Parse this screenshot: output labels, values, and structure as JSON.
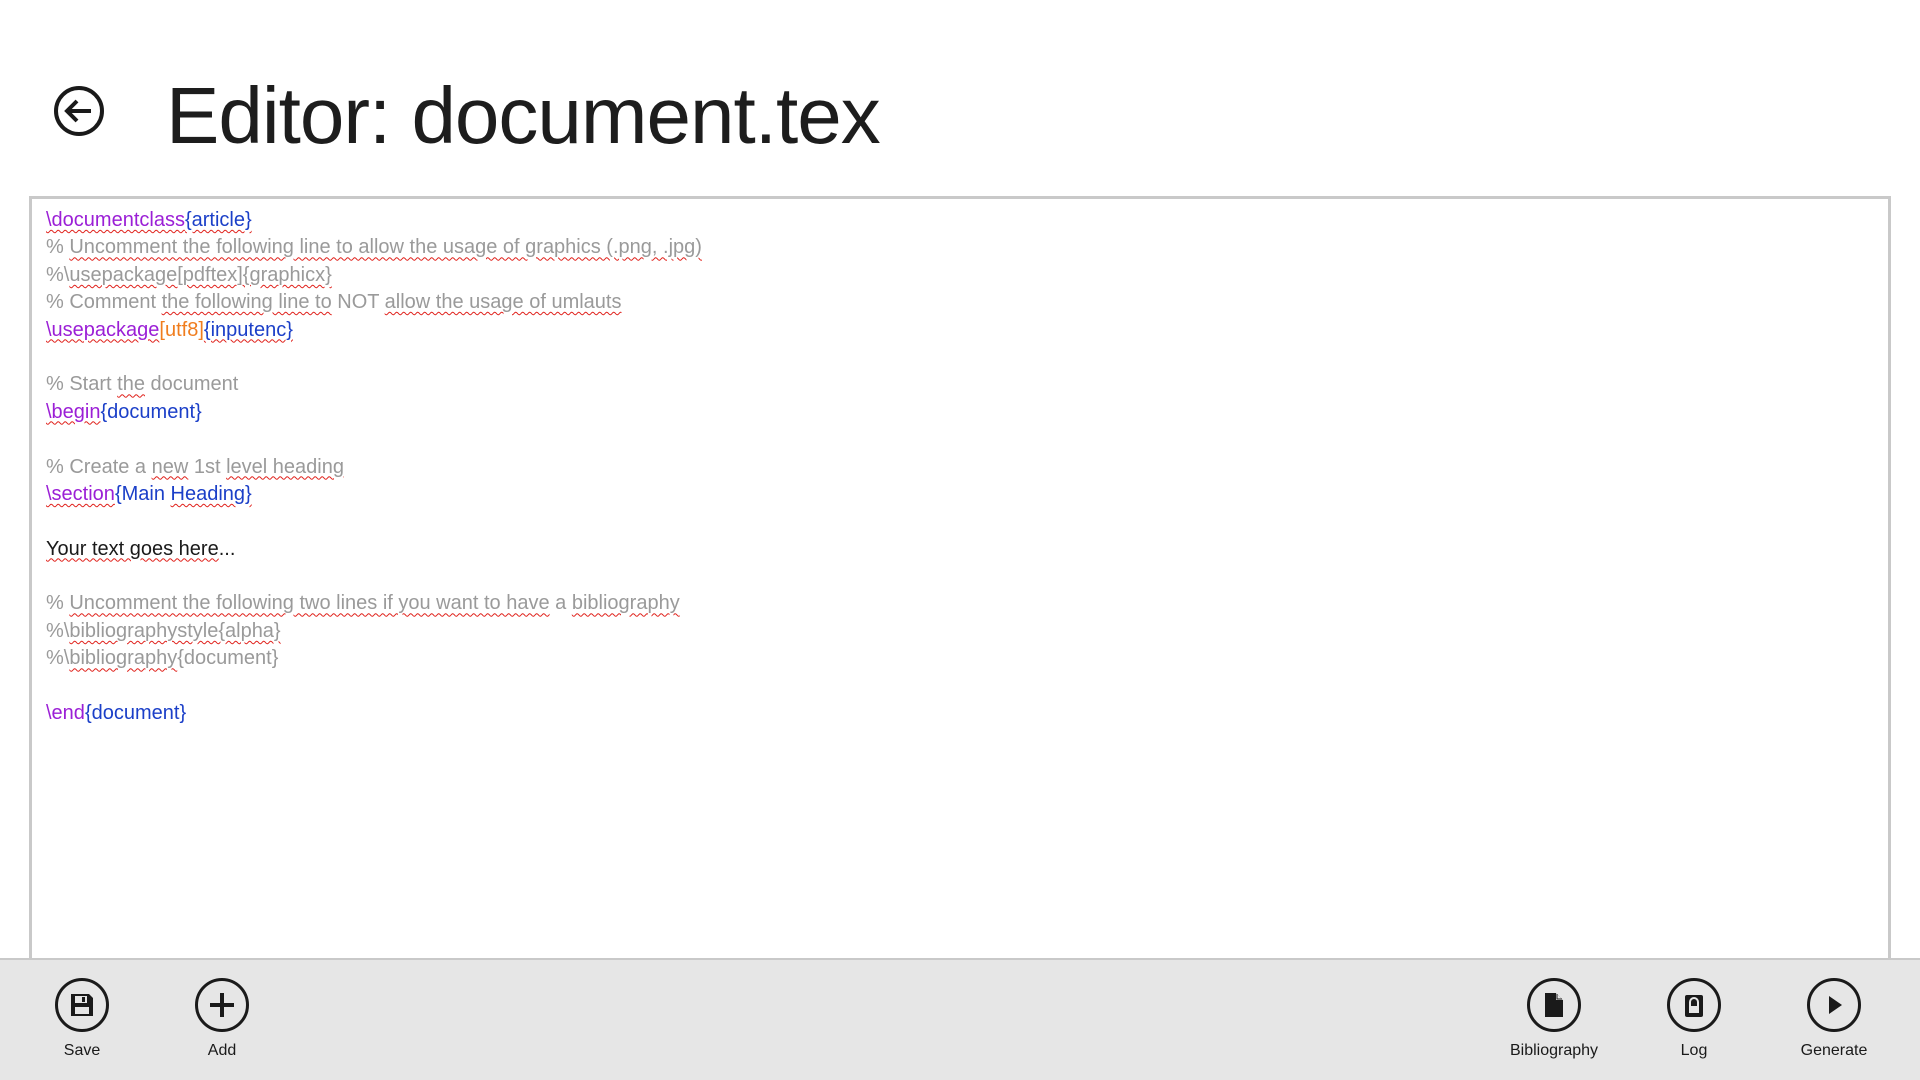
{
  "header": {
    "title": "Editor: document.tex"
  },
  "editor": {
    "lines": [
      [
        {
          "t": "\\documentclass",
          "c": "cmd",
          "s": true
        },
        {
          "t": "{article}",
          "c": "brace",
          "s": true
        }
      ],
      [
        {
          "t": "% ",
          "c": "comment"
        },
        {
          "t": "Uncomment the following line to allow the usage of graphics (.png, .jpg)",
          "c": "comment",
          "s": true
        }
      ],
      [
        {
          "t": "%\\",
          "c": "comment"
        },
        {
          "t": "usepackage[pdftex]{graphicx}",
          "c": "comment",
          "s": true
        }
      ],
      [
        {
          "t": "% Comment ",
          "c": "comment"
        },
        {
          "t": "the following line to",
          "c": "comment",
          "s": true
        },
        {
          "t": " NOT ",
          "c": "comment"
        },
        {
          "t": "allow the usage of umlauts",
          "c": "comment",
          "s": true
        }
      ],
      [
        {
          "t": "\\usepackage",
          "c": "cmd",
          "s": true
        },
        {
          "t": "[utf8]",
          "c": "opt"
        },
        {
          "t": "{inputenc}",
          "c": "brace",
          "s": true
        }
      ],
      [],
      [
        {
          "t": "% Start ",
          "c": "comment"
        },
        {
          "t": "the",
          "c": "comment",
          "s": true
        },
        {
          "t": " document",
          "c": "comment"
        }
      ],
      [
        {
          "t": "\\begin",
          "c": "cmd",
          "s": true
        },
        {
          "t": "{document}",
          "c": "brace"
        }
      ],
      [],
      [
        {
          "t": "% Create a ",
          "c": "comment"
        },
        {
          "t": "new",
          "c": "comment",
          "s": true
        },
        {
          "t": " 1st ",
          "c": "comment"
        },
        {
          "t": "level heading",
          "c": "comment",
          "s": true
        }
      ],
      [
        {
          "t": "\\section",
          "c": "cmd",
          "s": true
        },
        {
          "t": "{Main ",
          "c": "brace"
        },
        {
          "t": "Heading}",
          "c": "brace",
          "s": true
        }
      ],
      [],
      [
        {
          "t": "Your text goes here",
          "c": "text",
          "s": true
        },
        {
          "t": "...",
          "c": "text"
        }
      ],
      [],
      [
        {
          "t": "% ",
          "c": "comment"
        },
        {
          "t": "Uncomment the following two lines if you want to have",
          "c": "comment",
          "s": true
        },
        {
          "t": " a ",
          "c": "comment"
        },
        {
          "t": "bibliography",
          "c": "comment",
          "s": true
        }
      ],
      [
        {
          "t": "%\\",
          "c": "comment"
        },
        {
          "t": "bibliographystyle{alpha}",
          "c": "comment",
          "s": true
        }
      ],
      [
        {
          "t": "%\\",
          "c": "comment"
        },
        {
          "t": "bibliography",
          "c": "comment",
          "s": true
        },
        {
          "t": "{document}",
          "c": "comment"
        }
      ],
      [],
      [
        {
          "t": "\\end",
          "c": "cmd"
        },
        {
          "t": "{document}",
          "c": "brace"
        }
      ]
    ]
  },
  "appbar": {
    "save_label": "Save",
    "add_label": "Add",
    "bibliography_label": "Bibliography",
    "log_label": "Log",
    "generate_label": "Generate"
  },
  "icons": {
    "back": "back-arrow-icon",
    "save": "floppy-disk-icon",
    "add": "plus-icon",
    "bibliography": "document-icon",
    "log": "lock-icon",
    "generate": "play-icon"
  },
  "colors": {
    "command": "#9b1fd6",
    "brace": "#1b3fc8",
    "option": "#f07d1e",
    "comment": "#9a9a9a",
    "text": "#1a1a1a",
    "spellcheck": "#e0201a",
    "appbar": "#e6e6e6"
  }
}
